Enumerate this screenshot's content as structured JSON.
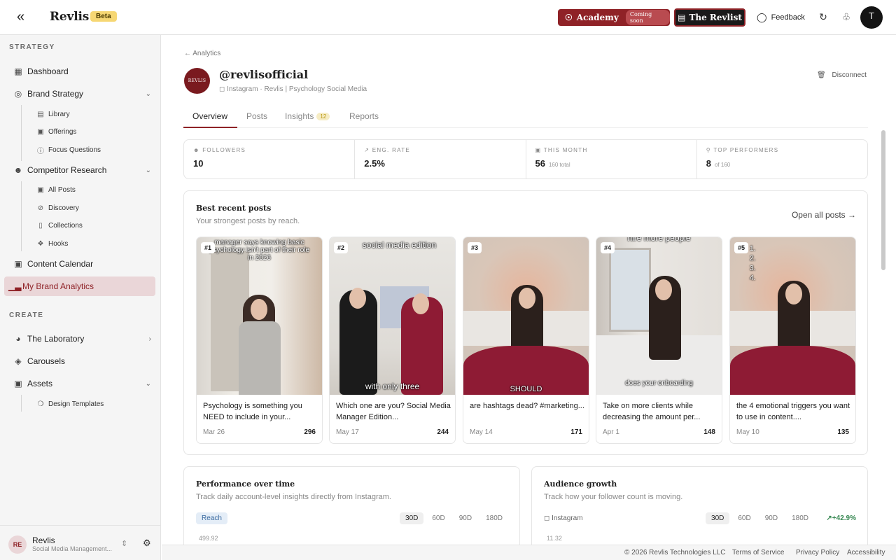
{
  "topbar": {
    "brand": "Revlis",
    "beta": "Beta",
    "academy": "Academy",
    "coming_soon": "Coming soon",
    "revlist": "The Revlist",
    "feedback": "Feedback",
    "user_initial": "T"
  },
  "sidebar": {
    "strategy_label": "STRATEGY",
    "create_label": "CREATE",
    "items": {
      "dashboard": "Dashboard",
      "brand_strategy": "Brand Strategy",
      "library": "Library",
      "offerings": "Offerings",
      "focus_questions": "Focus Questions",
      "competitor_research": "Competitor Research",
      "all_posts": "All Posts",
      "discovery": "Discovery",
      "collections": "Collections",
      "hooks": "Hooks",
      "content_calendar": "Content Calendar",
      "my_brand_analytics": "My Brand Analytics",
      "the_laboratory": "The Laboratory",
      "carousels": "Carousels",
      "assets": "Assets",
      "design_templates": "Design Templates"
    },
    "user": {
      "initials": "RE",
      "name": "Revlis",
      "subtitle": "Social Media Management..."
    }
  },
  "main": {
    "breadcrumb": "Analytics",
    "avatar_text": "REVLIS",
    "handle": "@revlisofficial",
    "platform": "Instagram",
    "description": "Revlis | Psychology Social Media",
    "disconnect": "Disconnect",
    "tabs": {
      "overview": "Overview",
      "posts": "Posts",
      "insights": "Insights",
      "insights_count": "12",
      "reports": "Reports"
    },
    "stats": [
      {
        "label": "FOLLOWERS",
        "value": "10",
        "extra": ""
      },
      {
        "label": "ENG. RATE",
        "value": "2.5%",
        "extra": ""
      },
      {
        "label": "THIS MONTH",
        "value": "56",
        "extra": "160 total"
      },
      {
        "label": "TOP PERFORMERS",
        "value": "8",
        "extra": "of 160"
      }
    ],
    "best": {
      "title": "Best recent posts",
      "subtitle": "Your strongest posts by reach.",
      "open_all": "Open all posts",
      "posts": [
        {
          "rank": "#1",
          "overlay": "manager says knowing basic psychology isn't part of their role in 2026",
          "caption": "Psychology is something you NEED to include in your...",
          "date": "Mar 26",
          "reach": "296"
        },
        {
          "rank": "#2",
          "overlay": "social media edition",
          "overlay2": "with only three",
          "caption": "Which one are you? Social Media Manager Edition...",
          "date": "May 17",
          "reach": "244"
        },
        {
          "rank": "#3",
          "overlay": "",
          "overlay2": "SHOULD",
          "caption": "are hashtags dead? #marketing...",
          "date": "May 14",
          "reach": "171"
        },
        {
          "rank": "#4",
          "overlay": "hire more people",
          "overlay2": "does your onboarding",
          "caption": "Take on more clients while decreasing the amount per...",
          "date": "Apr 1",
          "reach": "148"
        },
        {
          "rank": "#5",
          "overlay": "1.\n2.\n3.\n4.",
          "caption": "the 4 emotional triggers you want to use in content....",
          "date": "May 10",
          "reach": "135"
        }
      ]
    },
    "performance": {
      "title": "Performance over time",
      "subtitle": "Track daily account-level insights directly from Instagram.",
      "metric": "Reach",
      "ranges": [
        "30D",
        "60D",
        "90D",
        "180D"
      ],
      "axis_top": "499.92"
    },
    "audience": {
      "title": "Audience growth",
      "subtitle": "Track how your follower count is moving.",
      "platform": "Instagram",
      "ranges": [
        "30D",
        "60D",
        "90D",
        "180D"
      ],
      "growth": "+42.9%",
      "axis_top": "11.32"
    }
  },
  "footer": {
    "copyright": "© 2026 Revlis Technologies LLC",
    "terms": "Terms of Service",
    "privacy": "Privacy Policy",
    "accessibility": "Accessibility"
  },
  "colors": {
    "accent": "#8f2227",
    "beta": "#f6d774",
    "active_nav_bg": "#ead6d8"
  }
}
